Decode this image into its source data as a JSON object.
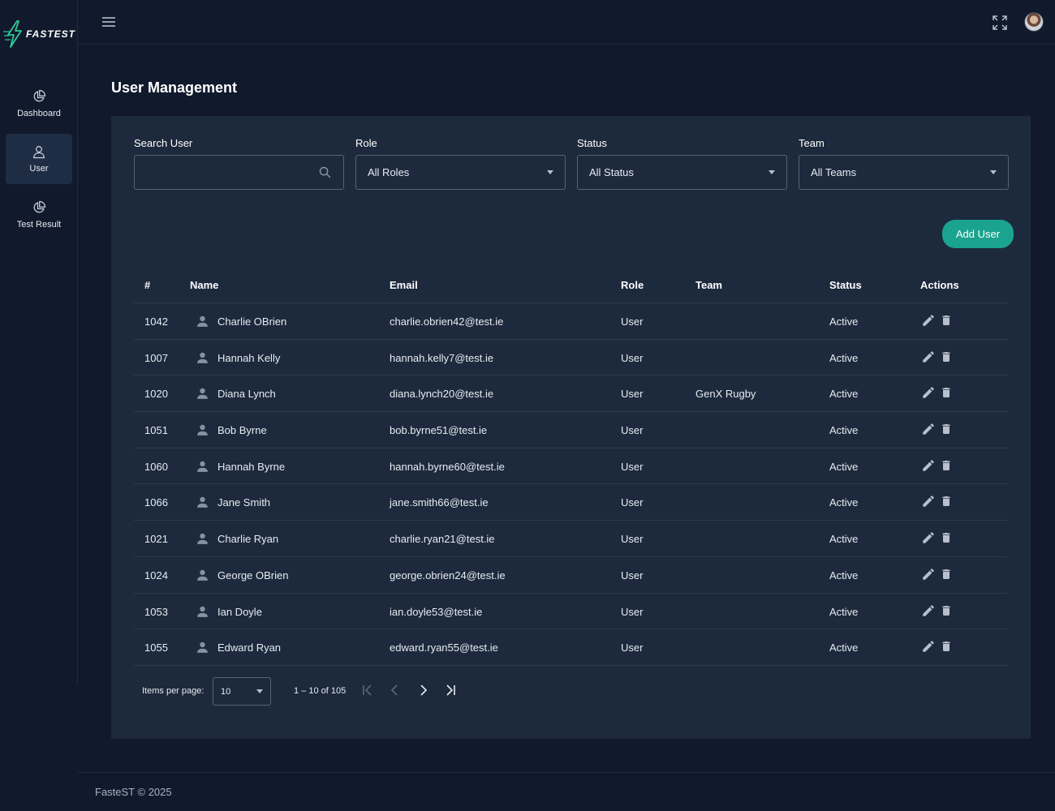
{
  "app": {
    "logo_text": "FASTEST",
    "footer": "FasteST © 2025"
  },
  "sidebar": {
    "items": [
      {
        "label": "Dashboard",
        "icon": "pie-chart-icon",
        "active": false
      },
      {
        "label": "User",
        "icon": "user-icon",
        "active": true
      },
      {
        "label": "Test Result",
        "icon": "pie-chart-icon",
        "active": false
      }
    ]
  },
  "page": {
    "title": "User Management"
  },
  "filters": {
    "search": {
      "label": "Search User",
      "value": "",
      "placeholder": ""
    },
    "role": {
      "label": "Role",
      "value": "All Roles"
    },
    "status": {
      "label": "Status",
      "value": "All Status"
    },
    "team": {
      "label": "Team",
      "value": "All Teams"
    }
  },
  "add_user_label": "Add User",
  "table": {
    "headers": [
      "#",
      "Name",
      "Email",
      "Role",
      "Team",
      "Status",
      "Actions"
    ],
    "rows": [
      {
        "id": "1042",
        "name": "Charlie OBrien",
        "email": "charlie.obrien42@test.ie",
        "role": "User",
        "team": "",
        "status": "Active"
      },
      {
        "id": "1007",
        "name": "Hannah Kelly",
        "email": "hannah.kelly7@test.ie",
        "role": "User",
        "team": "",
        "status": "Active"
      },
      {
        "id": "1020",
        "name": "Diana Lynch",
        "email": "diana.lynch20@test.ie",
        "role": "User",
        "team": "GenX Rugby",
        "status": "Active"
      },
      {
        "id": "1051",
        "name": "Bob Byrne",
        "email": "bob.byrne51@test.ie",
        "role": "User",
        "team": "",
        "status": "Active"
      },
      {
        "id": "1060",
        "name": "Hannah Byrne",
        "email": "hannah.byrne60@test.ie",
        "role": "User",
        "team": "",
        "status": "Active"
      },
      {
        "id": "1066",
        "name": "Jane Smith",
        "email": "jane.smith66@test.ie",
        "role": "User",
        "team": "",
        "status": "Active"
      },
      {
        "id": "1021",
        "name": "Charlie Ryan",
        "email": "charlie.ryan21@test.ie",
        "role": "User",
        "team": "",
        "status": "Active"
      },
      {
        "id": "1024",
        "name": "George OBrien",
        "email": "george.obrien24@test.ie",
        "role": "User",
        "team": "",
        "status": "Active"
      },
      {
        "id": "1053",
        "name": "Ian Doyle",
        "email": "ian.doyle53@test.ie",
        "role": "User",
        "team": "",
        "status": "Active"
      },
      {
        "id": "1055",
        "name": "Edward Ryan",
        "email": "edward.ryan55@test.ie",
        "role": "User",
        "team": "",
        "status": "Active"
      }
    ]
  },
  "pagination": {
    "items_per_page_label": "Items per page:",
    "items_per_page": "10",
    "range": "1 – 10 of 105"
  },
  "colors": {
    "background": "#111a2c",
    "card": "#1d2a3d",
    "accent": "#1aa38f",
    "logo_accent": "#2ecc9a"
  }
}
